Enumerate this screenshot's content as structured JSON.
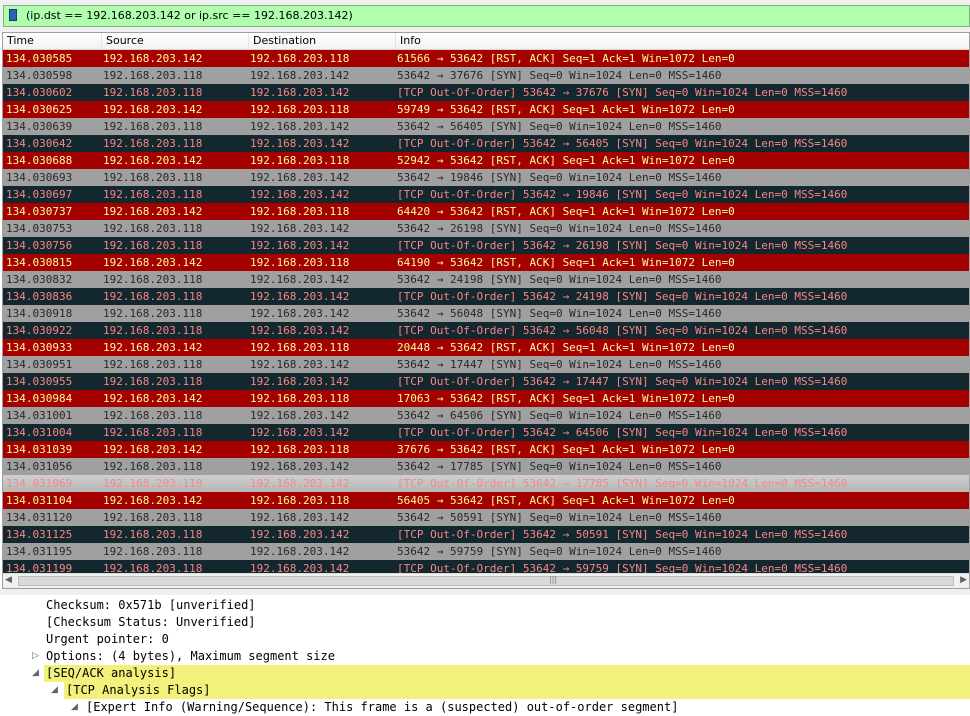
{
  "filter": {
    "text": "(ip.dst == 192.168.203.142 or ip.src == 192.168.203.142)",
    "bookmark_icon": "bookmark-icon"
  },
  "packet_list": {
    "columns": [
      "Time",
      "Source",
      "Destination",
      "Info"
    ],
    "rows": [
      {
        "type": "rst",
        "time": "134.030585",
        "src": "192.168.203.142",
        "dst": "192.168.203.118",
        "info": "61566 → 53642 [RST, ACK] Seq=1 Ack=1 Win=1072 Len=0"
      },
      {
        "type": "syn",
        "time": "134.030598",
        "src": "192.168.203.118",
        "dst": "192.168.203.142",
        "info": "53642 → 37676 [SYN] Seq=0 Win=1024 Len=0 MSS=1460"
      },
      {
        "type": "ooo",
        "time": "134.030602",
        "src": "192.168.203.118",
        "dst": "192.168.203.142",
        "info": "[TCP Out-Of-Order] 53642 → 37676 [SYN] Seq=0 Win=1024 Len=0 MSS=1460"
      },
      {
        "type": "rst",
        "time": "134.030625",
        "src": "192.168.203.142",
        "dst": "192.168.203.118",
        "info": "59749 → 53642 [RST, ACK] Seq=1 Ack=1 Win=1072 Len=0"
      },
      {
        "type": "syn",
        "time": "134.030639",
        "src": "192.168.203.118",
        "dst": "192.168.203.142",
        "info": "53642 → 56405 [SYN] Seq=0 Win=1024 Len=0 MSS=1460"
      },
      {
        "type": "ooo",
        "time": "134.030642",
        "src": "192.168.203.118",
        "dst": "192.168.203.142",
        "info": "[TCP Out-Of-Order] 53642 → 56405 [SYN] Seq=0 Win=1024 Len=0 MSS=1460"
      },
      {
        "type": "rst",
        "time": "134.030688",
        "src": "192.168.203.142",
        "dst": "192.168.203.118",
        "info": "52942 → 53642 [RST, ACK] Seq=1 Ack=1 Win=1072 Len=0"
      },
      {
        "type": "syn",
        "time": "134.030693",
        "src": "192.168.203.118",
        "dst": "192.168.203.142",
        "info": "53642 → 19846 [SYN] Seq=0 Win=1024 Len=0 MSS=1460"
      },
      {
        "type": "ooo",
        "time": "134.030697",
        "src": "192.168.203.118",
        "dst": "192.168.203.142",
        "info": "[TCP Out-Of-Order] 53642 → 19846 [SYN] Seq=0 Win=1024 Len=0 MSS=1460"
      },
      {
        "type": "rst",
        "time": "134.030737",
        "src": "192.168.203.142",
        "dst": "192.168.203.118",
        "info": "64420 → 53642 [RST, ACK] Seq=1 Ack=1 Win=1072 Len=0"
      },
      {
        "type": "syn",
        "time": "134.030753",
        "src": "192.168.203.118",
        "dst": "192.168.203.142",
        "info": "53642 → 26198 [SYN] Seq=0 Win=1024 Len=0 MSS=1460"
      },
      {
        "type": "ooo",
        "time": "134.030756",
        "src": "192.168.203.118",
        "dst": "192.168.203.142",
        "info": "[TCP Out-Of-Order] 53642 → 26198 [SYN] Seq=0 Win=1024 Len=0 MSS=1460"
      },
      {
        "type": "rst",
        "time": "134.030815",
        "src": "192.168.203.142",
        "dst": "192.168.203.118",
        "info": "64190 → 53642 [RST, ACK] Seq=1 Ack=1 Win=1072 Len=0"
      },
      {
        "type": "syn",
        "time": "134.030832",
        "src": "192.168.203.118",
        "dst": "192.168.203.142",
        "info": "53642 → 24198 [SYN] Seq=0 Win=1024 Len=0 MSS=1460"
      },
      {
        "type": "ooo",
        "time": "134.030836",
        "src": "192.168.203.118",
        "dst": "192.168.203.142",
        "info": "[TCP Out-Of-Order] 53642 → 24198 [SYN] Seq=0 Win=1024 Len=0 MSS=1460"
      },
      {
        "type": "syn",
        "time": "134.030918",
        "src": "192.168.203.118",
        "dst": "192.168.203.142",
        "info": "53642 → 56048 [SYN] Seq=0 Win=1024 Len=0 MSS=1460"
      },
      {
        "type": "ooo",
        "time": "134.030922",
        "src": "192.168.203.118",
        "dst": "192.168.203.142",
        "info": "[TCP Out-Of-Order] 53642 → 56048 [SYN] Seq=0 Win=1024 Len=0 MSS=1460"
      },
      {
        "type": "rst",
        "time": "134.030933",
        "src": "192.168.203.142",
        "dst": "192.168.203.118",
        "info": "20448 → 53642 [RST, ACK] Seq=1 Ack=1 Win=1072 Len=0"
      },
      {
        "type": "syn",
        "time": "134.030951",
        "src": "192.168.203.118",
        "dst": "192.168.203.142",
        "info": "53642 → 17447 [SYN] Seq=0 Win=1024 Len=0 MSS=1460"
      },
      {
        "type": "ooo",
        "time": "134.030955",
        "src": "192.168.203.118",
        "dst": "192.168.203.142",
        "info": "[TCP Out-Of-Order] 53642 → 17447 [SYN] Seq=0 Win=1024 Len=0 MSS=1460"
      },
      {
        "type": "rst",
        "time": "134.030984",
        "src": "192.168.203.142",
        "dst": "192.168.203.118",
        "info": "17063 → 53642 [RST, ACK] Seq=1 Ack=1 Win=1072 Len=0"
      },
      {
        "type": "syn",
        "time": "134.031001",
        "src": "192.168.203.118",
        "dst": "192.168.203.142",
        "info": "53642 → 64506 [SYN] Seq=0 Win=1024 Len=0 MSS=1460"
      },
      {
        "type": "ooo",
        "time": "134.031004",
        "src": "192.168.203.118",
        "dst": "192.168.203.142",
        "info": "[TCP Out-Of-Order] 53642 → 64506 [SYN] Seq=0 Win=1024 Len=0 MSS=1460"
      },
      {
        "type": "rst",
        "time": "134.031039",
        "src": "192.168.203.142",
        "dst": "192.168.203.118",
        "info": "37676 → 53642 [RST, ACK] Seq=1 Ack=1 Win=1072 Len=0"
      },
      {
        "type": "syn",
        "time": "134.031056",
        "src": "192.168.203.118",
        "dst": "192.168.203.142",
        "info": "53642 → 17785 [SYN] Seq=0 Win=1024 Len=0 MSS=1460"
      },
      {
        "type": "sel",
        "time": "134.031069",
        "src": "192.168.203.118",
        "dst": "192.168.203.142",
        "info": "[TCP Out-Of-Order] 53642 → 17785 [SYN] Seq=0 Win=1024 Len=0 MSS=1460"
      },
      {
        "type": "rst",
        "time": "134.031104",
        "src": "192.168.203.142",
        "dst": "192.168.203.118",
        "info": "56405 → 53642 [RST, ACK] Seq=1 Ack=1 Win=1072 Len=0"
      },
      {
        "type": "syn",
        "time": "134.031120",
        "src": "192.168.203.118",
        "dst": "192.168.203.142",
        "info": "53642 → 50591 [SYN] Seq=0 Win=1024 Len=0 MSS=1460"
      },
      {
        "type": "ooo",
        "time": "134.031125",
        "src": "192.168.203.118",
        "dst": "192.168.203.142",
        "info": "[TCP Out-Of-Order] 53642 → 50591 [SYN] Seq=0 Win=1024 Len=0 MSS=1460"
      },
      {
        "type": "syn",
        "time": "134.031195",
        "src": "192.168.203.118",
        "dst": "192.168.203.142",
        "info": "53642 → 59759 [SYN] Seq=0 Win=1024 Len=0 MSS=1460"
      },
      {
        "type": "ooo",
        "time": "134.031199",
        "src": "192.168.203.118",
        "dst": "192.168.203.142",
        "info": "[TCP Out-Of-Order] 53642 → 59759 [SYN] Seq=0 Win=1024 Len=0 MSS=1460"
      }
    ],
    "colors": {
      "rst_bg": "#a40000",
      "rst_fg": "#fffc9c",
      "syn_bg": "#a0a0a0",
      "syn_fg": "#282828",
      "ooo_bg": "#12272e",
      "ooo_fg": "#f78787"
    }
  },
  "details": {
    "checksum": "Checksum: 0x571b [unverified]",
    "checksum_status": "[Checksum Status: Unverified]",
    "urgent": "Urgent pointer: 0",
    "options": "Options: (4 bytes), Maximum segment size",
    "seq_ack": "[SEQ/ACK analysis]",
    "analysis_flags": "[TCP Analysis Flags]",
    "expert_info": "[Expert Info (Warning/Sequence): This frame is a (suspected) out-of-order segment]",
    "arrow_collapsed": "▷",
    "arrow_expanded": "◢"
  }
}
